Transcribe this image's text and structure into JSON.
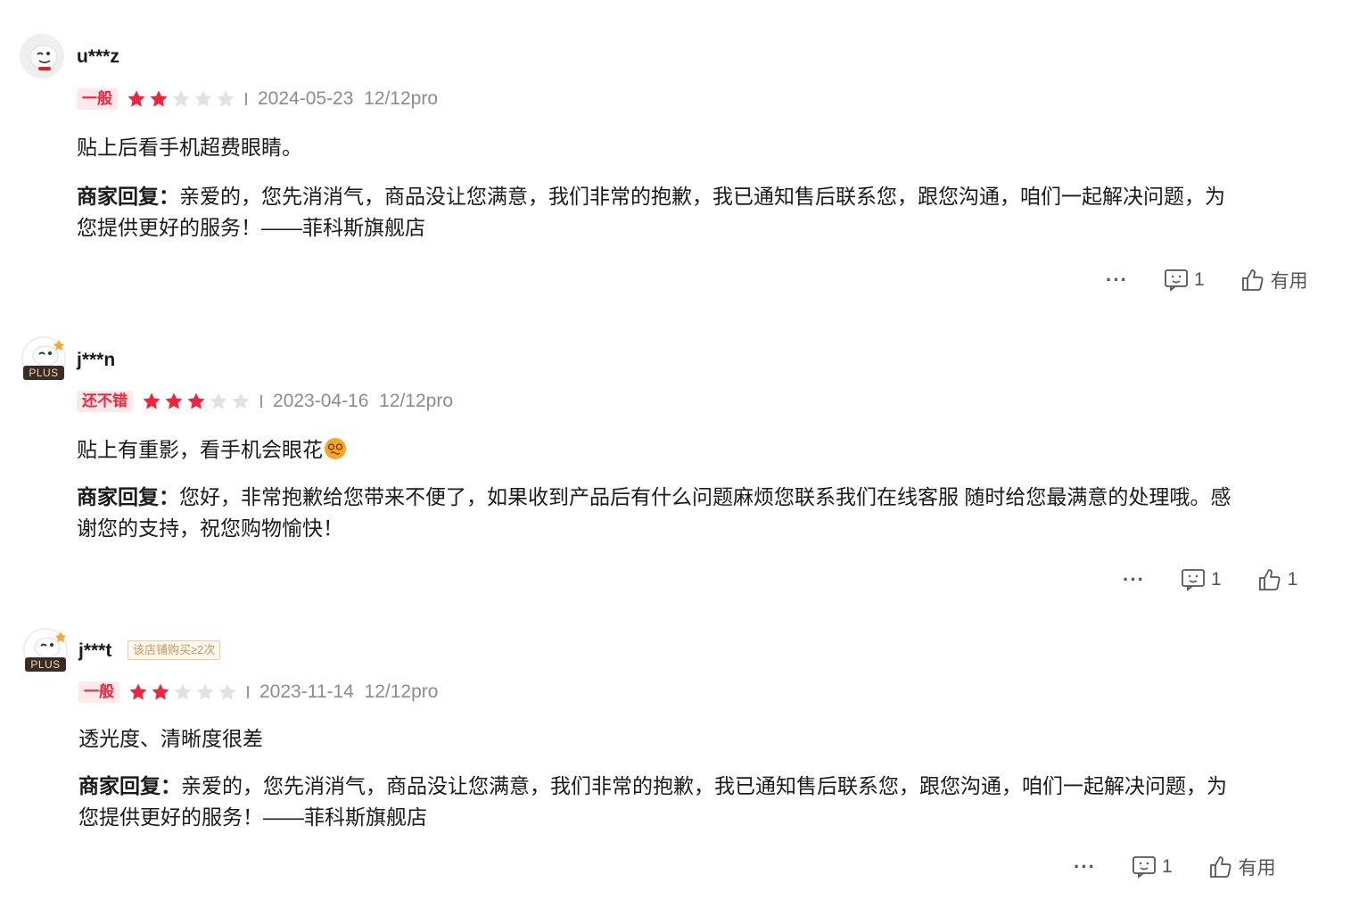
{
  "reviews": [
    {
      "username": "u***z",
      "plus": false,
      "buy_tag": "",
      "rating_label": "一般",
      "stars": 2,
      "date": "2024-05-23",
      "variant": "12/12pro",
      "content": "贴上后看手机超费眼睛。",
      "reply_label": "商家回复：",
      "reply_line1": "亲爱的，您先消消气，商品没让您满意，我们非常的抱歉，我已通知售后联系您，跟您沟通，咱们一起解决问题，为",
      "reply_line2": "您提供更好的服务！——菲科斯旗舰店",
      "more": "···",
      "comment_count": "1",
      "useful_label": "有用"
    },
    {
      "username": "j***n",
      "plus": true,
      "plus_text": "PLUS",
      "buy_tag": "",
      "rating_label": "还不错",
      "stars": 3,
      "date": "2023-04-16",
      "variant": "12/12pro",
      "content": "贴上有重影，看手机会眼花",
      "reply_label": "商家回复：",
      "reply_line1": "您好，非常抱歉给您带来不便了，如果收到产品后有什么问题麻烦您联系我们在线客服 随时给您最满意的处理哦。感",
      "reply_line2": "谢您的支持，祝您购物愉快！",
      "more": "···",
      "comment_count": "1",
      "useful_label": "1"
    },
    {
      "username": "j***t",
      "plus": true,
      "plus_text": "PLUS",
      "buy_tag": "该店铺购买≥2次",
      "rating_label": "一般",
      "stars": 2,
      "date": "2023-11-14",
      "variant": "12/12pro",
      "content": "透光度、清晰度很差",
      "reply_label": "商家回复：",
      "reply_line1": "亲爱的，您先消消气，商品没让您满意，我们非常的抱歉，我已通知售后联系您，跟您沟通，咱们一起解决问题，为",
      "reply_line2": "您提供更好的服务！——菲科斯旗舰店",
      "more": "···",
      "comment_count": "1",
      "useful_label": "有用"
    }
  ],
  "colors": {
    "star_on": "#f0243c",
    "star_off": "#e2e2e2",
    "label_red": "#f0243c",
    "meta_gray": "#8c8c8c"
  }
}
